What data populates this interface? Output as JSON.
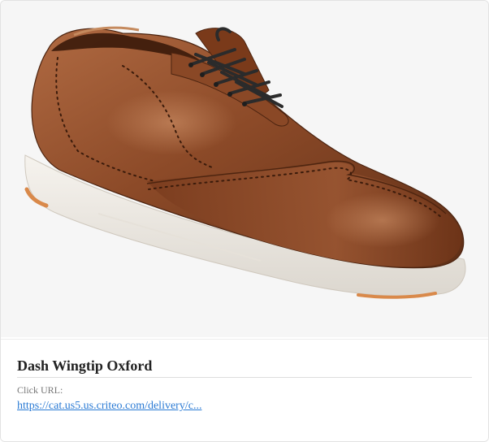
{
  "product": {
    "image_alt": "Dash Wingtip Oxford shoe",
    "title": "Dash Wingtip Oxford",
    "url_label": "Click URL:",
    "url_text": "https://cat.us5.us.criteo.com/delivery/c..."
  },
  "colors": {
    "leather": "#8a4a2a",
    "leather_dark": "#5e2e16",
    "sole": "#eeeae4",
    "link": "#2a7ad4",
    "title": "#222222"
  }
}
